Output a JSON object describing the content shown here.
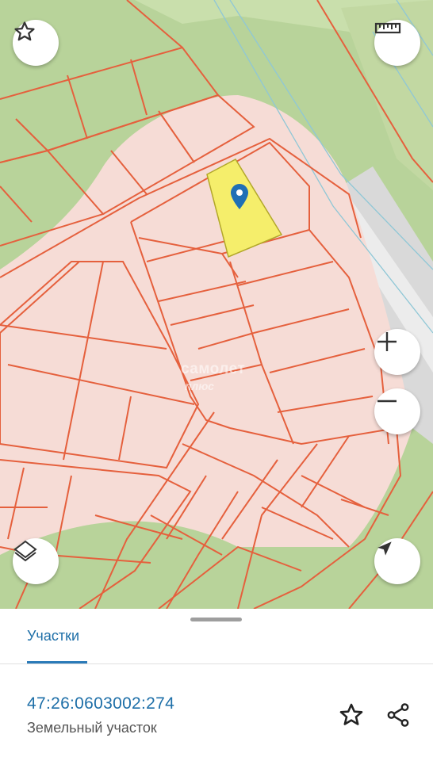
{
  "map": {
    "watermark_line1": "самолет",
    "watermark_line2": "плюс",
    "controls": {
      "favorite": "star-icon",
      "ruler": "ruler-icon",
      "zoom_in": "plus-icon",
      "zoom_out": "minus-icon",
      "layers": "layers-icon",
      "locate": "navigation-arrow-icon"
    },
    "colors": {
      "forest": "#b8d39a",
      "developed_area": "#f6dcd6",
      "parcel_border": "#e5603d",
      "selected_parcel": "#f5ee6b",
      "pin": "#1f6fb5"
    }
  },
  "sheet": {
    "tab_label": "Участки",
    "parcel": {
      "cadastral_number": "47:26:0603002:274",
      "type": "Земельный участок"
    },
    "actions": {
      "favorite": "star-outline-icon",
      "share": "share-icon"
    }
  }
}
